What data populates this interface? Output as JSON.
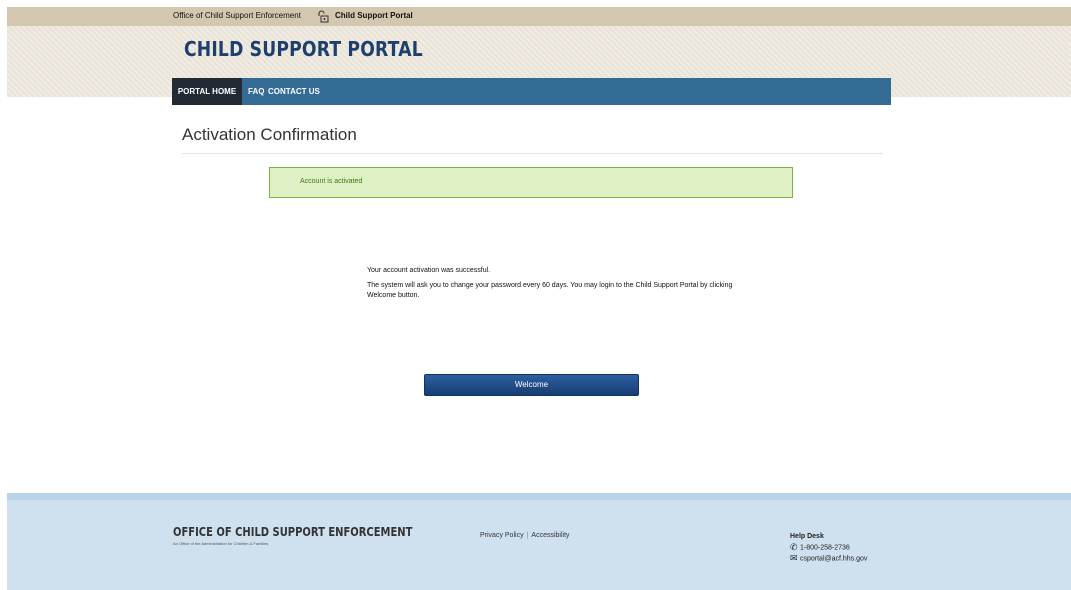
{
  "topbar": {
    "crumb_office": "Office of Child Support Enforcement",
    "crumb_portal": "Child Support Portal"
  },
  "header": {
    "brand": "CHILD SUPPORT PORTAL"
  },
  "nav": {
    "items": [
      {
        "label": "PORTAL HOME"
      },
      {
        "label": "FAQ"
      },
      {
        "label": "CONTACT US"
      }
    ]
  },
  "main": {
    "title": "Activation Confirmation",
    "alert": "Account is activated",
    "message_1": "Your account activation was successful.",
    "message_2": "The system will ask you to change your password every 60 days. You may login to the Child Support Portal by clicking Welcome button.",
    "welcome_button": "Welcome"
  },
  "footer": {
    "org_name": "OFFICE OF CHILD SUPPORT ENFORCEMENT",
    "org_sub": "An Office of the Administration for Children & Families",
    "privacy": "Privacy Policy",
    "separator": "|",
    "accessibility": "Accessibility",
    "help_title": "Help Desk",
    "phone": "1-800-258-2736",
    "email": "csportal@acf.hhs.gov"
  },
  "colors": {
    "nav_bg": "#336b95",
    "nav_active_bg": "#222b33",
    "brand_text": "#1e3f6e",
    "alert_bg": "#dff0c5",
    "alert_border": "#7bb33d",
    "button_bg": "#1f4a86",
    "footer_bg": "#cfe0ef"
  },
  "icons": {
    "lock": "lock-icon",
    "phone": "phone-icon",
    "email": "envelope-icon"
  }
}
